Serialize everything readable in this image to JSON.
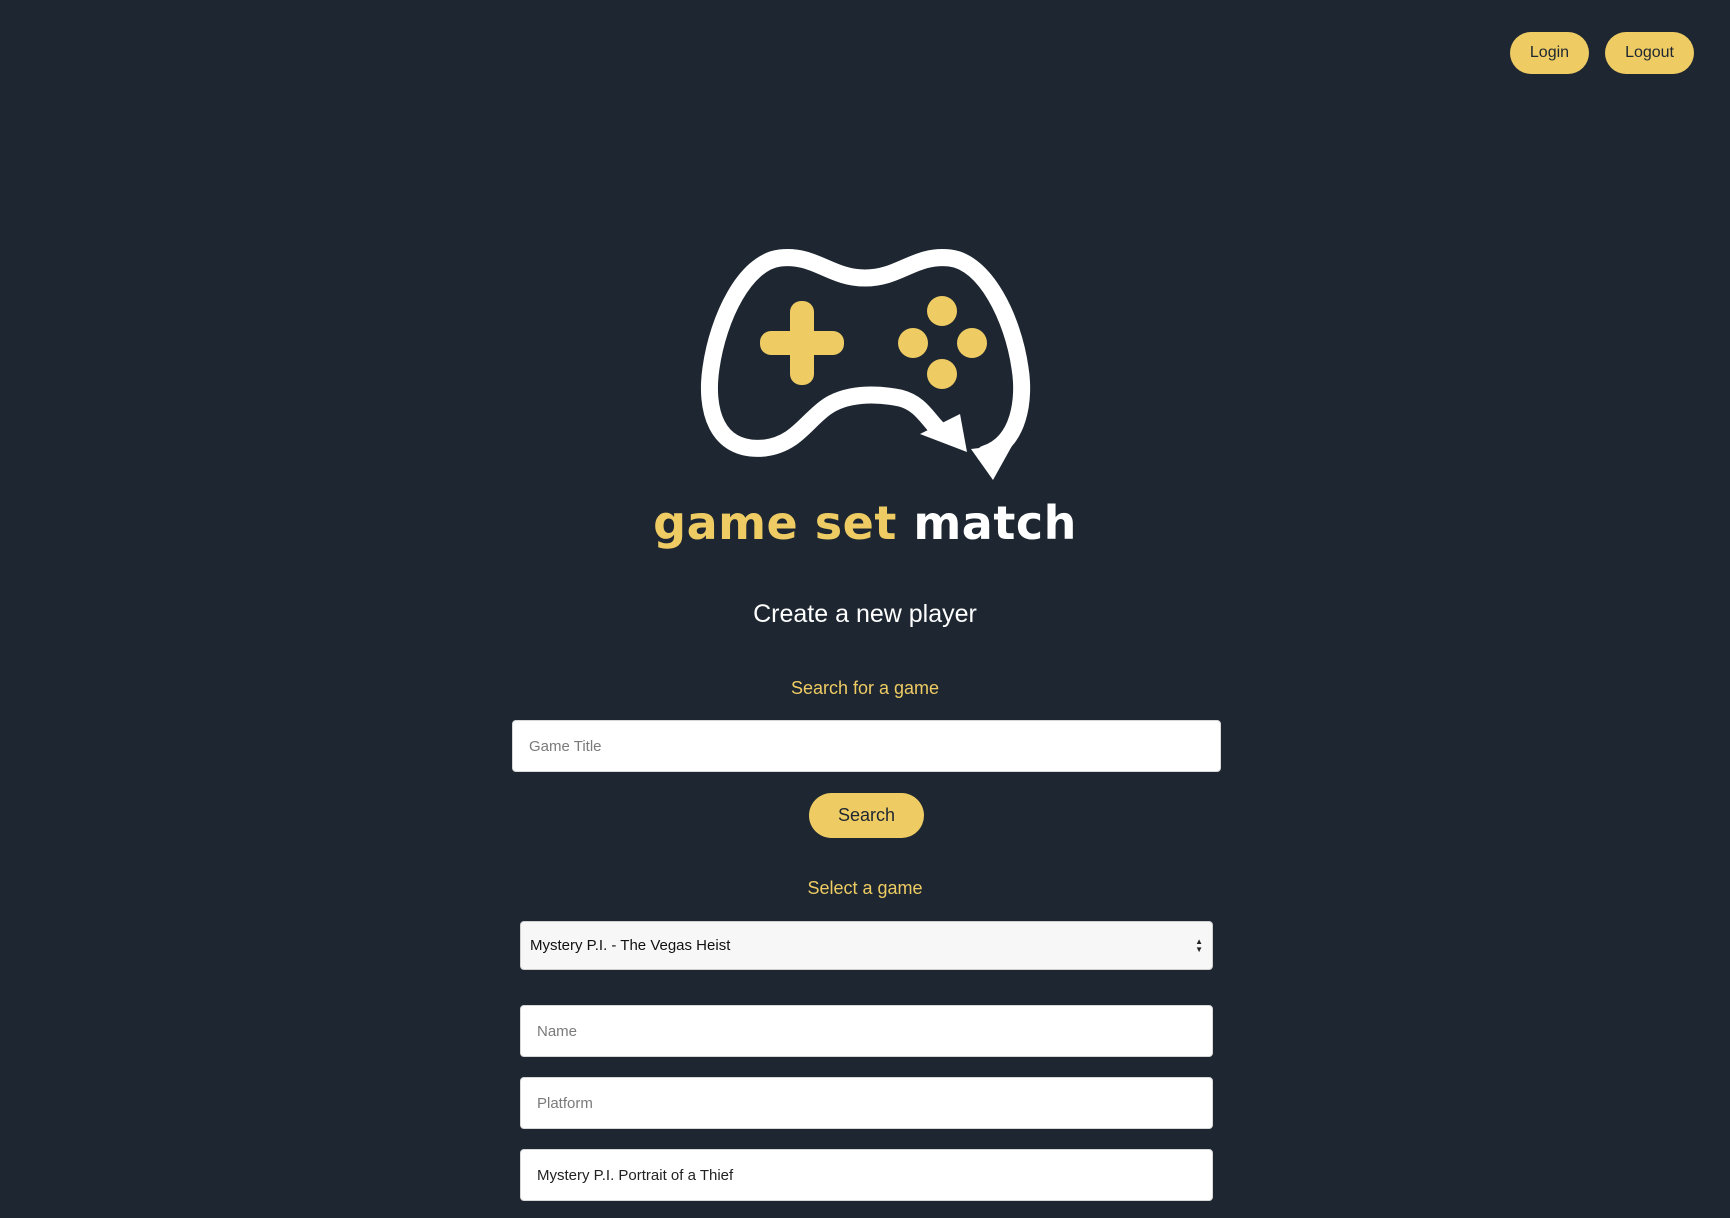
{
  "nav": {
    "login_label": "Login",
    "logout_label": "Logout"
  },
  "logo": {
    "word_game": "game",
    "word_set": "set",
    "word_match": "match"
  },
  "page": {
    "heading": "Create a new player"
  },
  "search": {
    "label": "Search for a game",
    "placeholder": "Game Title",
    "value": "",
    "button_label": "Search"
  },
  "select_game": {
    "label": "Select a game",
    "selected": "Mystery P.I. - The Vegas Heist"
  },
  "form": {
    "name_placeholder": "Name",
    "name_value": "",
    "platform_placeholder": "Platform",
    "platform_value": "",
    "game_value": "Mystery P.I. Portrait of a Thief"
  },
  "colors": {
    "background": "#1e2731",
    "accent": "#eecb63",
    "text_light": "#ffffff"
  },
  "icons": {
    "logo": "game-controller-icon",
    "select_arrows": "updown-arrows-icon"
  }
}
